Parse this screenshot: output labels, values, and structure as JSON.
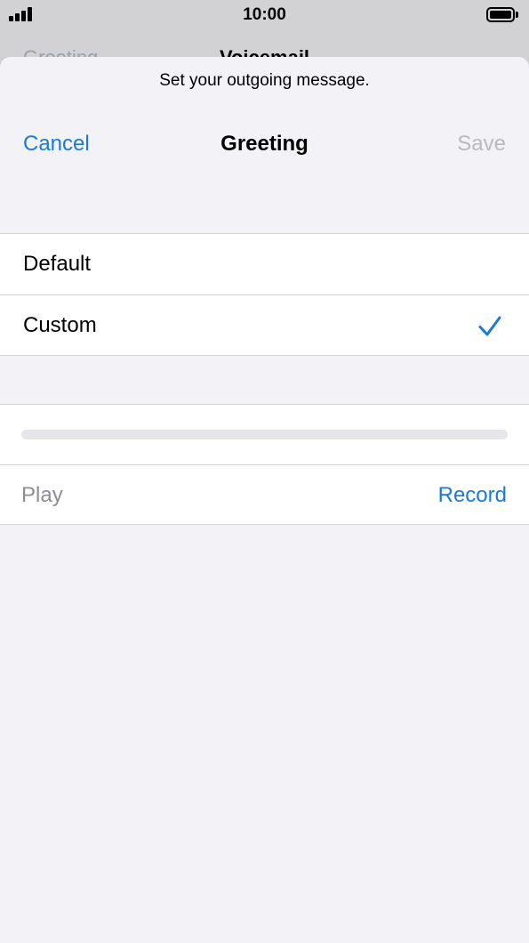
{
  "status_bar": {
    "time": "10:00",
    "signal_icon": "cellular-signal-icon",
    "battery_icon": "battery-full-icon",
    "battery_level": 1.0
  },
  "behind": {
    "left_label": "Greeting",
    "title": "Voicemail"
  },
  "sheet": {
    "prompt": "Set your outgoing message.",
    "nav": {
      "cancel_label": "Cancel",
      "title": "Greeting",
      "save_label": "Save"
    },
    "options": [
      {
        "label": "Default",
        "selected": false
      },
      {
        "label": "Custom",
        "selected": true
      }
    ],
    "checkmark_icon": "checkmark-icon",
    "recording": {
      "progress": 0,
      "play_label": "Play",
      "record_label": "Record"
    }
  },
  "colors": {
    "accent": "#1a7ad8",
    "disabled": "#b9b9be",
    "secondary_text": "#8e8e93",
    "sheet_background": "#f2f2f7",
    "separator": "#d3d3d8"
  }
}
